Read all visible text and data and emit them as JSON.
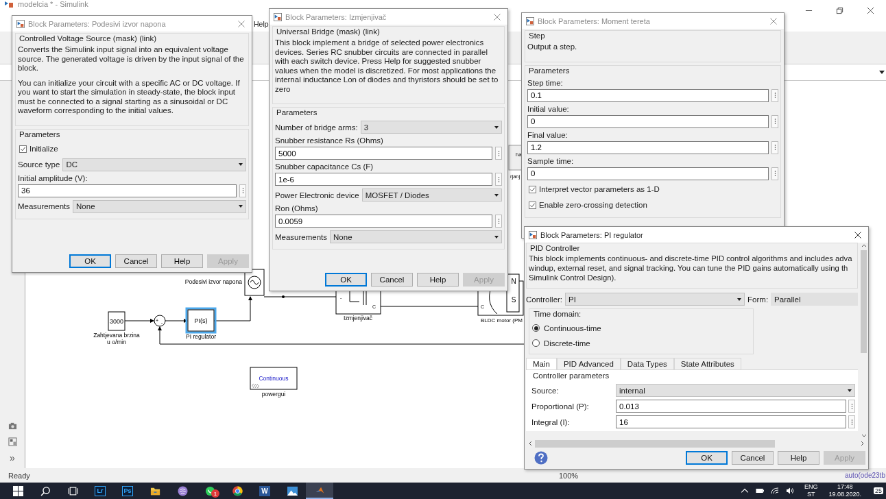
{
  "main_window": {
    "title": "modelcia * - Simulink",
    "menu": [
      "Help"
    ],
    "left_toolbar_glyph": "»"
  },
  "diagram": {
    "blocks": [
      {
        "kind": "fragment",
        "texts": [
          "ha",
          "rjanj"
        ]
      },
      {
        "kind": "source",
        "label": "Podesivi izvor napona"
      },
      {
        "kind": "bridge",
        "label": "Izmjenjivač",
        "ports": [
          "-",
          "C"
        ]
      },
      {
        "kind": "motor",
        "label": "BLDC motor (PM",
        "poles": [
          "N",
          "S"
        ],
        "port": "C"
      },
      {
        "kind": "constant",
        "text": "3000",
        "label_lines": [
          "Zahtjevana brzina",
          "u o/min"
        ]
      },
      {
        "kind": "sum",
        "signs": [
          "+",
          "-"
        ]
      },
      {
        "kind": "transfer",
        "text": "PI(s)",
        "label": "PI regulator",
        "selected": true
      },
      {
        "kind": "powergui",
        "text": "Continuous",
        "label": "powergui"
      }
    ]
  },
  "dialogs": [
    {
      "title": "Block Parameters: Podesivi izvor napona",
      "active": false,
      "header": "Controlled Voltage Source (mask) (link)",
      "description": [
        "Converts the Simulink input signal into an equivalent voltage source. The generated voltage is driven by the input signal of the block.",
        "You can initialize your circuit with a specific AC or DC voltage. If you want to start the simulation in steady-state, the block input must be connected to a signal starting as a sinusoidal or DC waveform corresponding to the initial values."
      ],
      "params_title": "Parameters",
      "params": [
        {
          "kind": "check",
          "label": "Initialize",
          "checked": true
        },
        {
          "kind": "select",
          "label": "Source type",
          "value": "DC"
        },
        {
          "kind": "field",
          "label": "Initial amplitude (V):",
          "value": "36"
        },
        {
          "kind": "select",
          "label": "Measurements",
          "value": "None"
        }
      ],
      "buttons": [
        {
          "label": "OK",
          "default": true,
          "disabled": false
        },
        {
          "label": "Cancel",
          "default": false,
          "disabled": false
        },
        {
          "label": "Help",
          "default": false,
          "disabled": false
        },
        {
          "label": "Apply",
          "default": false,
          "disabled": true
        }
      ]
    },
    {
      "title": "Block Parameters: Izmjenjivač",
      "active": false,
      "header": "Universal Bridge (mask) (link)",
      "description": [
        "This block implement a bridge of selected power electronics devices.  Series RC snubber circuits are connected in parallel with each switch device.  Press Help for suggested snubber values when the model is discretized. For most applications the internal inductance Lon of diodes and thyristors should be set to zero"
      ],
      "params_title": "Parameters",
      "params": [
        {
          "kind": "select",
          "label": "Number of bridge arms:",
          "value": "3"
        },
        {
          "kind": "field",
          "label": "Snubber resistance Rs (Ohms)",
          "value": "5000"
        },
        {
          "kind": "field",
          "label": "Snubber capacitance Cs (F)",
          "value": "1e-6"
        },
        {
          "kind": "select",
          "label": "Power Electronic device",
          "value": "MOSFET / Diodes"
        },
        {
          "kind": "field",
          "label": "Ron (Ohms)",
          "value": "0.0059"
        },
        {
          "kind": "select",
          "label": "Measurements",
          "value": "None"
        }
      ],
      "buttons": [
        {
          "label": "OK",
          "default": true,
          "disabled": false
        },
        {
          "label": "Cancel",
          "default": false,
          "disabled": false
        },
        {
          "label": "Help",
          "default": false,
          "disabled": false
        },
        {
          "label": "Apply",
          "default": false,
          "disabled": true
        }
      ]
    },
    {
      "title": "Block Parameters: Moment tereta",
      "active": false,
      "header": "Step",
      "description": [
        "Output a step."
      ],
      "params_title": "Parameters",
      "params": [
        {
          "kind": "field",
          "label": "Step time:",
          "value": "0.1"
        },
        {
          "kind": "field",
          "label": "Initial value:",
          "value": "0"
        },
        {
          "kind": "field",
          "label": "Final value:",
          "value": "1.2"
        },
        {
          "kind": "field",
          "label": "Sample time:",
          "value": "0"
        },
        {
          "kind": "check",
          "label": "Interpret vector parameters as 1-D",
          "checked": true
        },
        {
          "kind": "check",
          "label": "Enable zero-crossing detection",
          "checked": true
        }
      ]
    },
    {
      "title": "Block Parameters: PI regulator",
      "active": true,
      "header": "PID Controller",
      "description": [
        "This block implements continuous- and discrete-time PID control algorithms and includes adva",
        "windup, external reset, and signal tracking. You can tune the PID gains automatically using th",
        "Simulink Control Design)."
      ],
      "controller": {
        "label": "Controller:",
        "value": "PI"
      },
      "form": {
        "label": "Form:",
        "value": "Parallel"
      },
      "time_domain": {
        "title": "Time domain:",
        "options": [
          {
            "label": "Continuous-time",
            "selected": true
          },
          {
            "label": "Discrete-time",
            "selected": false
          }
        ]
      },
      "tabs": [
        {
          "label": "Main",
          "selected": true
        },
        {
          "label": "PID Advanced",
          "selected": false
        },
        {
          "label": "Data Types",
          "selected": false
        },
        {
          "label": "State Attributes",
          "selected": false
        }
      ],
      "tab_section": "Controller parameters",
      "params": [
        {
          "kind": "row-select",
          "label": "Source:",
          "value": "internal"
        },
        {
          "kind": "row-field",
          "label": "Proportional (P):",
          "value": "0.013"
        },
        {
          "kind": "row-field",
          "label": "Integral (I):",
          "value": "16"
        }
      ],
      "buttons": [
        {
          "label": "OK",
          "default": true,
          "disabled": false
        },
        {
          "label": "Cancel",
          "default": false,
          "disabled": false
        },
        {
          "label": "Help",
          "default": false,
          "disabled": false
        },
        {
          "label": "Apply",
          "default": false,
          "disabled": true
        }
      ]
    }
  ],
  "status_bar": {
    "state": "Ready",
    "zoom": "100%",
    "solver": "auto(ode23tb"
  },
  "taskbar": {
    "apps": [
      {
        "kind": "start",
        "active": false
      },
      {
        "kind": "search",
        "active": false
      },
      {
        "kind": "task-view",
        "active": false
      },
      {
        "kind": "tile",
        "text": "Lr",
        "active": false
      },
      {
        "kind": "tile",
        "text": "Ps",
        "active": false
      },
      {
        "kind": "folder",
        "active": false
      },
      {
        "kind": "disc",
        "active": false
      },
      {
        "kind": "chat",
        "badge": "1",
        "active": false
      },
      {
        "kind": "browser",
        "active": false
      },
      {
        "kind": "doc",
        "text": "W",
        "active": false
      },
      {
        "kind": "picture",
        "active": false
      },
      {
        "kind": "peak",
        "active": true
      }
    ],
    "language": "ENG",
    "layout": "ST",
    "time": "17:48",
    "date": "19.08.2020.",
    "notifications": "25"
  }
}
